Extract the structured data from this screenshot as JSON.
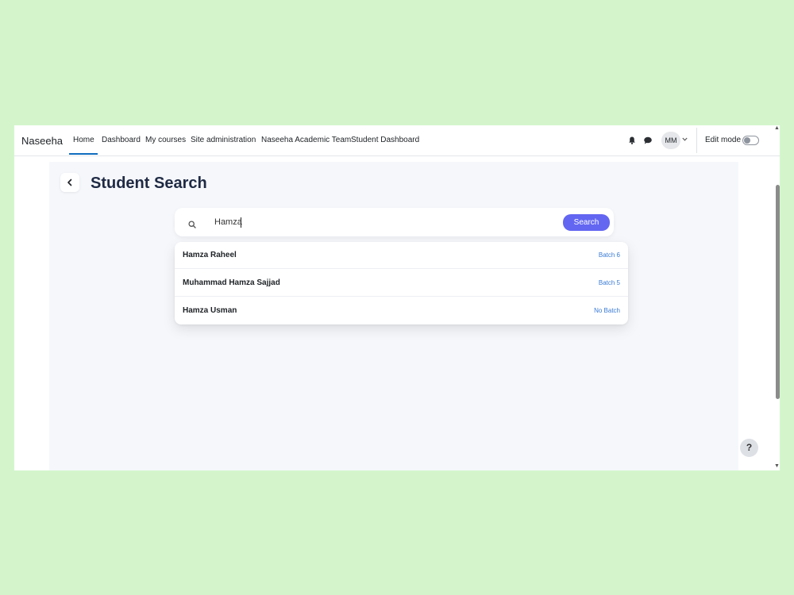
{
  "navbar": {
    "brand": "Naseeha",
    "links": [
      {
        "label": "Home",
        "active": true
      },
      {
        "label": "Dashboard"
      },
      {
        "label": "My courses"
      },
      {
        "label": "Site administration"
      },
      {
        "label": "Naseeha Academic Team"
      },
      {
        "label": "Student Dashboard"
      }
    ],
    "icons": [
      "bell-icon",
      "chat-icon"
    ],
    "avatar_initials": "MM",
    "edit_mode_label": "Edit mode",
    "edit_mode_on": false
  },
  "page": {
    "title": "Student Search",
    "search": {
      "value": "Hamza",
      "button_label": "Search"
    },
    "results": [
      {
        "name": "Hamza Raheel",
        "batch": "Batch 6"
      },
      {
        "name": "Muhammad Hamza Sajjad",
        "batch": "Batch 5"
      },
      {
        "name": "Hamza Usman",
        "batch": "No Batch"
      }
    ],
    "help_label": "?"
  },
  "colors": {
    "background": "#d4f5cc",
    "accent": "#6366f1",
    "nav_active": "#0f6cbf",
    "batch_text": "#3a7bd5"
  }
}
